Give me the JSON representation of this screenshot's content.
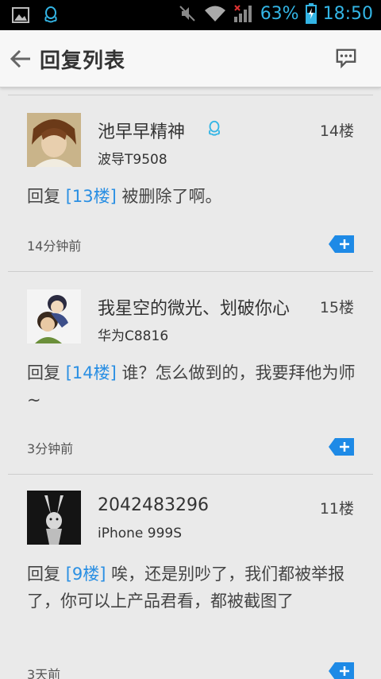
{
  "status_bar": {
    "battery": "63%",
    "time": "18:50"
  },
  "header": {
    "title": "回复列表"
  },
  "replies": [
    {
      "username": "池早早精神",
      "floor": "14楼",
      "device": "波导T9508",
      "reply_word": "回复",
      "ref": "[13楼]",
      "text": "被删除了啊。",
      "time": "14分钟前"
    },
    {
      "username": "我星空的微光、划破你心",
      "floor": "15楼",
      "device": "华为C8816",
      "reply_word": "回复",
      "ref": "[14楼]",
      "text": "谁？怎么做到的，我要拜他为师~",
      "time": "3分钟前"
    },
    {
      "username": "2042483296",
      "floor": "11楼",
      "device": "iPhone 999S",
      "reply_word": "回复",
      "ref": "[9楼]",
      "text": "唉，还是别吵了，我们都被举报了，你可以上产品君看，都被截图了",
      "time": "3天前"
    }
  ]
}
